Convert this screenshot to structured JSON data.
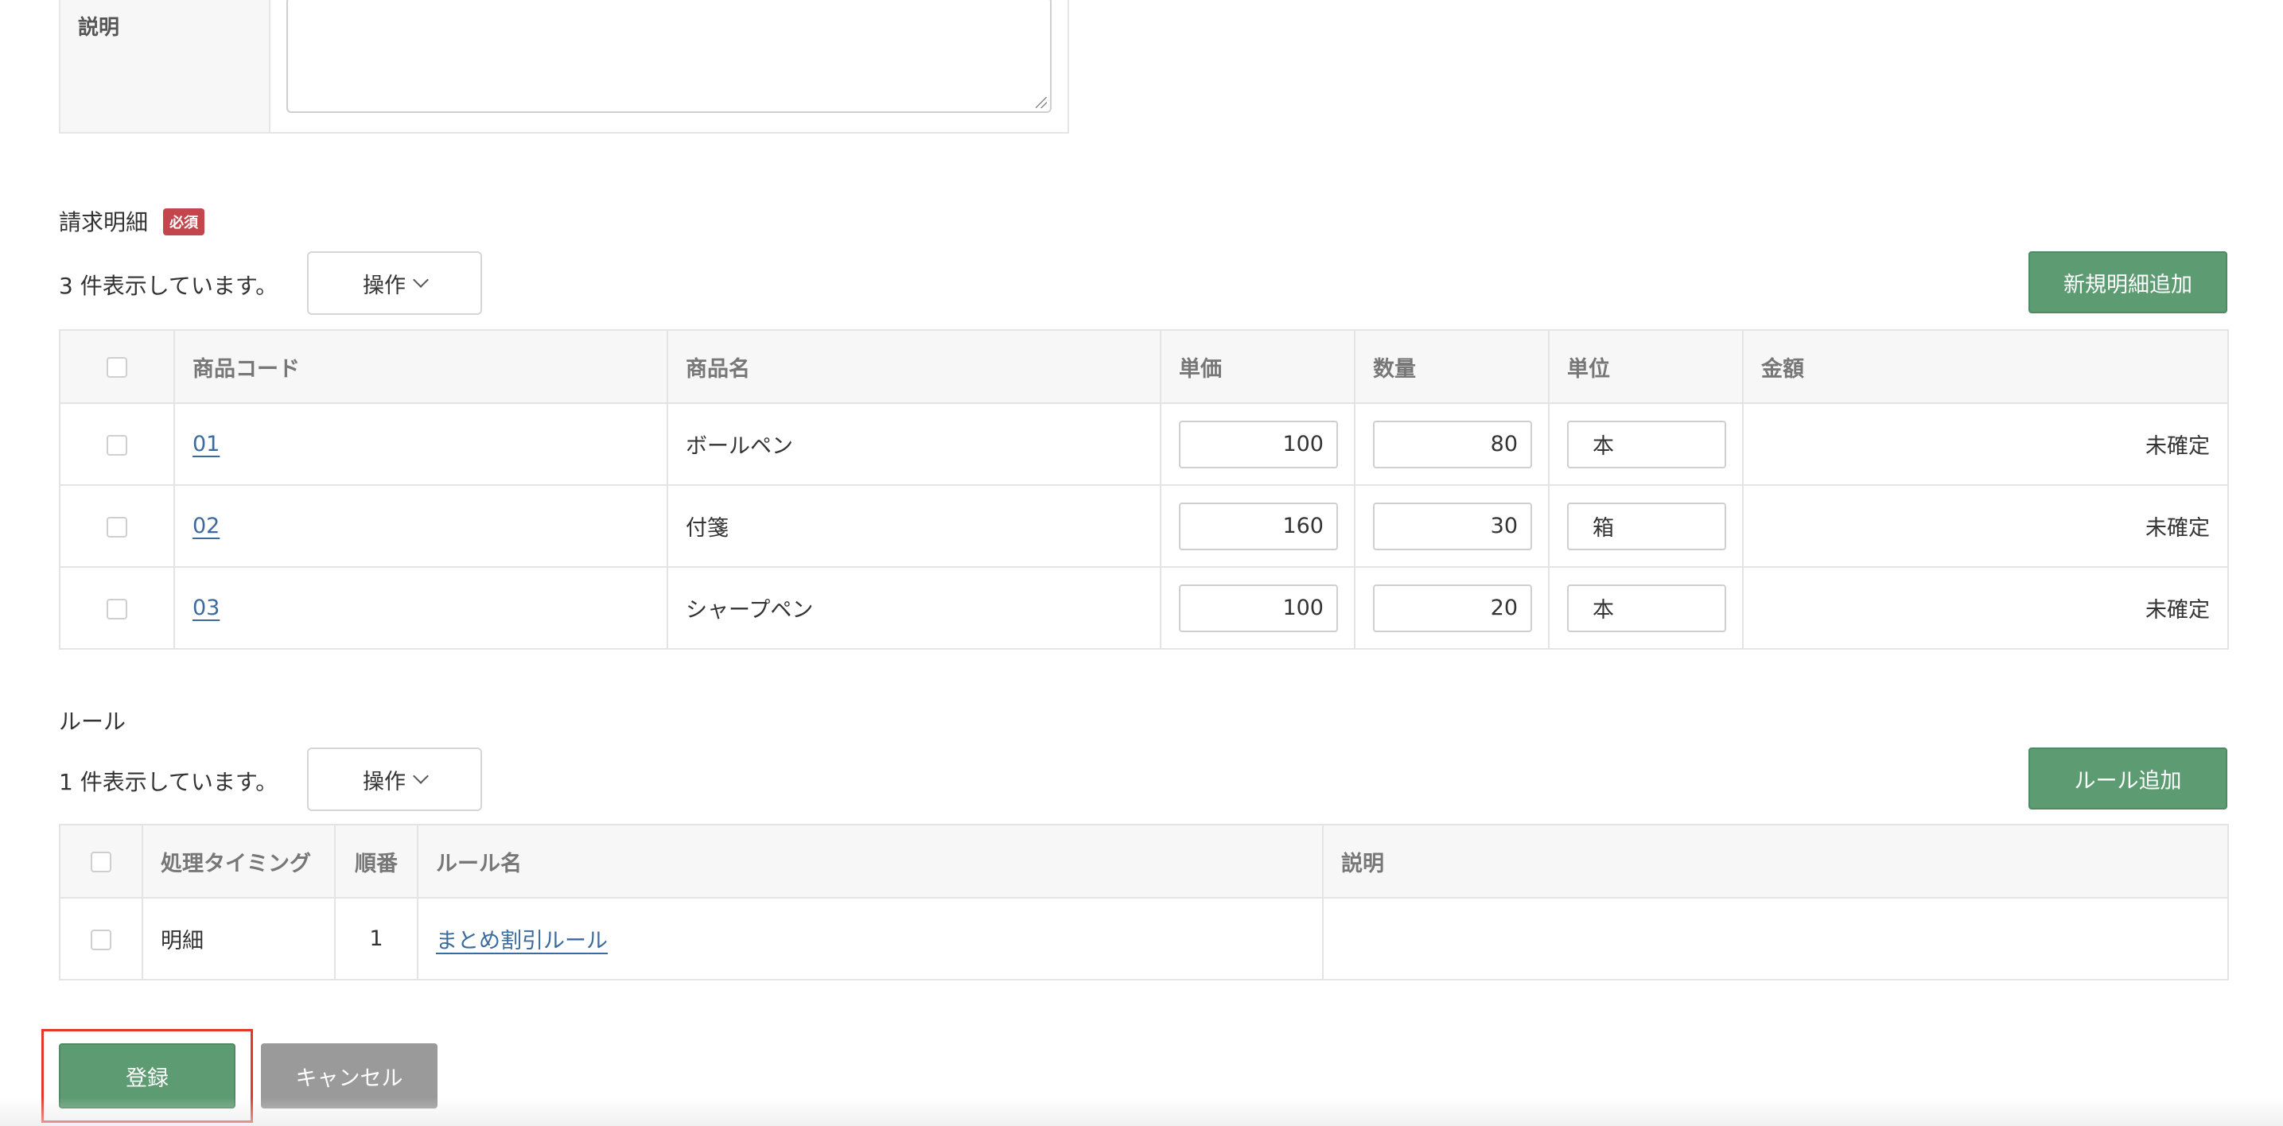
{
  "description": {
    "label": "説明",
    "value": ""
  },
  "billing_details": {
    "title": "請求明細",
    "required_badge": "必須",
    "count_text": "3 件表示しています。",
    "operation_button": "操作",
    "add_button": "新規明細追加",
    "columns": [
      "商品コード",
      "商品名",
      "単価",
      "数量",
      "単位",
      "金額"
    ],
    "rows": [
      {
        "code": "01",
        "name": "ボールペン",
        "unit_price": "100",
        "quantity": "80",
        "unit": "本",
        "amount": "未確定"
      },
      {
        "code": "02",
        "name": "付箋",
        "unit_price": "160",
        "quantity": "30",
        "unit": "箱",
        "amount": "未確定"
      },
      {
        "code": "03",
        "name": "シャープペン",
        "unit_price": "100",
        "quantity": "20",
        "unit": "本",
        "amount": "未確定"
      }
    ]
  },
  "rules": {
    "title": "ルール",
    "count_text": "1 件表示しています。",
    "operation_button": "操作",
    "add_button": "ルール追加",
    "columns": [
      "処理タイミング",
      "順番",
      "ルール名",
      "説明"
    ],
    "rows": [
      {
        "timing": "明細",
        "order": "1",
        "name": "まとめ割引ルール",
        "description": ""
      }
    ]
  },
  "footer": {
    "submit_button": "登録",
    "cancel_button": "キャンセル"
  },
  "colors": {
    "primary_green": "#5d9b72",
    "required_red": "#c2464b",
    "link_blue": "#3b6a9e",
    "highlight_red": "#e0392b"
  },
  "icons": {
    "dropdown": "chevron-down-icon"
  }
}
